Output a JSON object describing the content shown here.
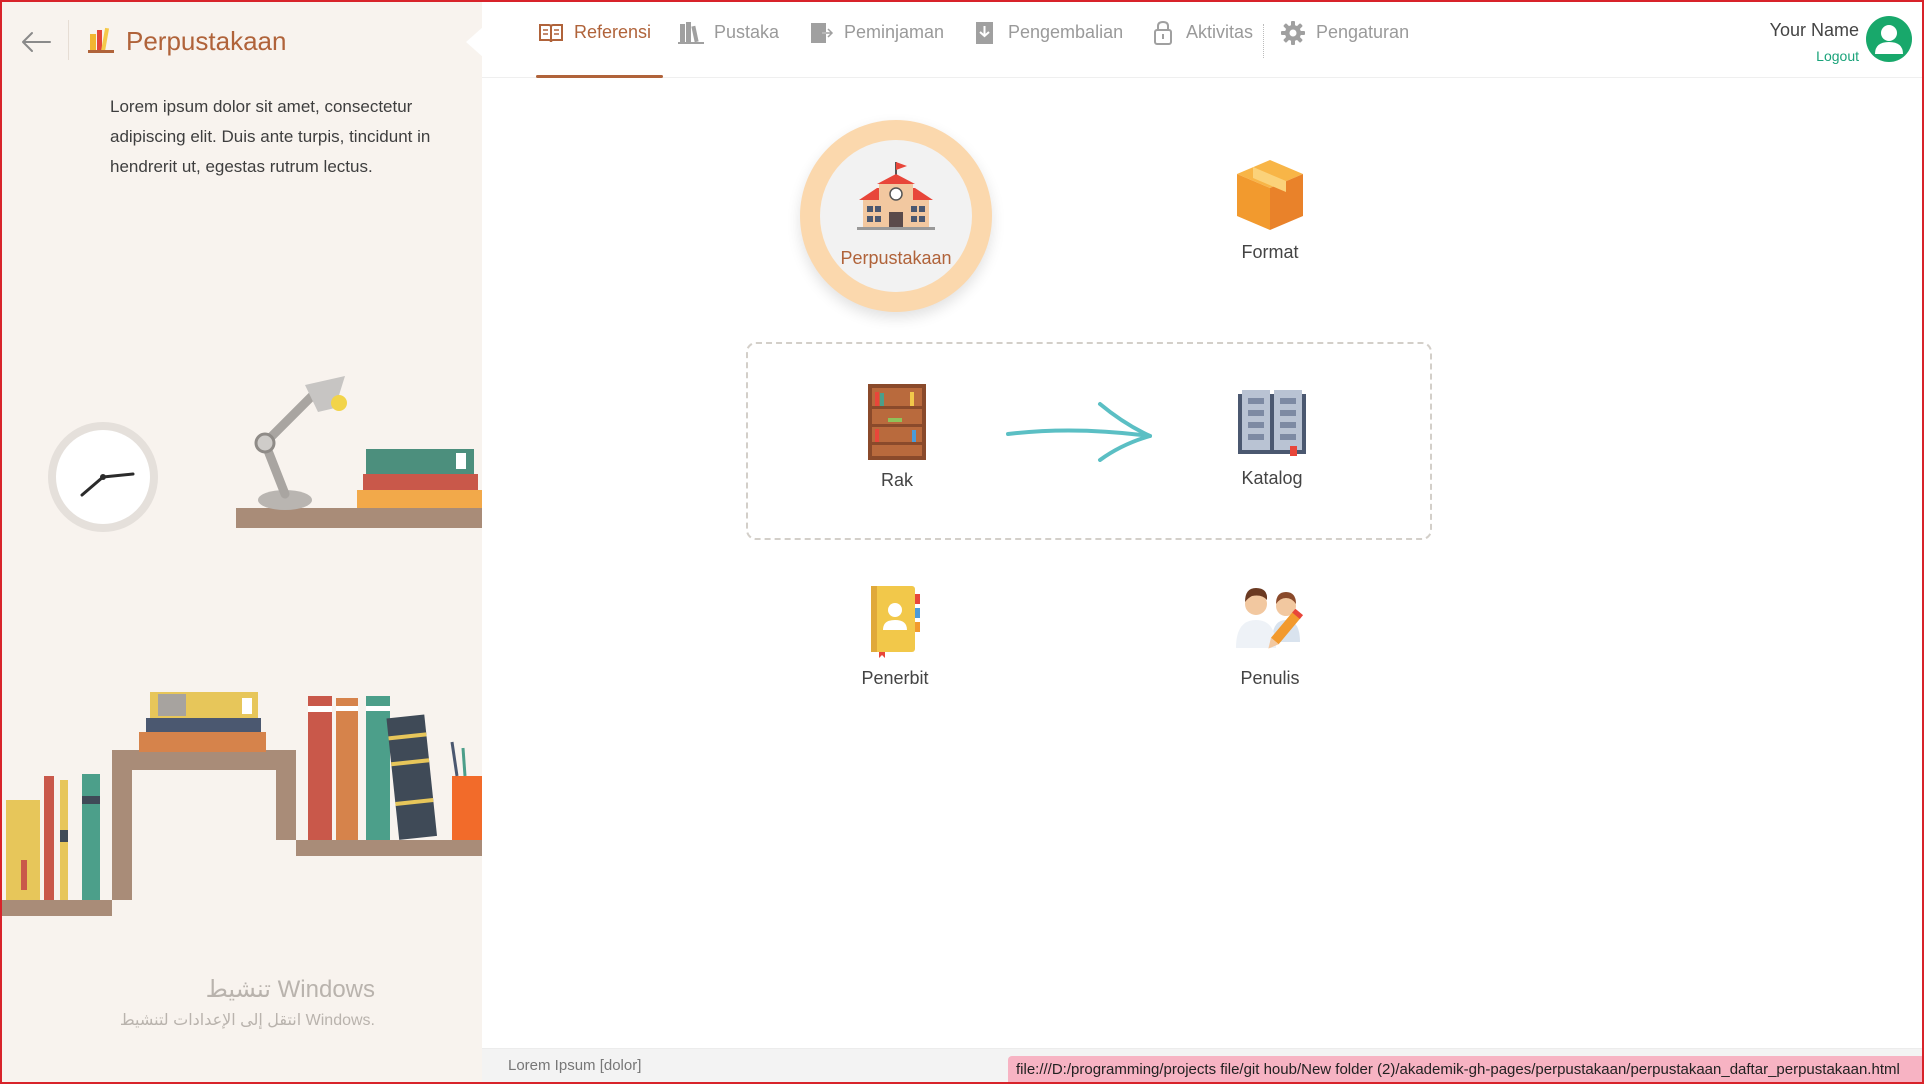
{
  "app": {
    "title": "Perpustakaan",
    "description": "Lorem ipsum dolor sit amet, consectetur adipiscing elit. Duis ante turpis, tincidunt in hendrerit ut, egestas rutrum lectus."
  },
  "nav": {
    "tabs": [
      {
        "label": "Referensi",
        "icon": "book-open-icon",
        "active": true
      },
      {
        "label": "Pustaka",
        "icon": "books-icon",
        "active": false
      },
      {
        "label": "Peminjaman",
        "icon": "borrow-icon",
        "active": false
      },
      {
        "label": "Pengembalian",
        "icon": "return-icon",
        "active": false
      },
      {
        "label": "Aktivitas",
        "icon": "activity-icon",
        "active": false
      },
      {
        "label": "Pengaturan",
        "icon": "gear-icon",
        "active": false
      }
    ]
  },
  "user": {
    "name": "Your Name",
    "logout_label": "Logout"
  },
  "tiles": {
    "perpustakaan": "Perpustakaan",
    "format": "Format",
    "rak": "Rak",
    "katalog": "Katalog",
    "penerbit": "Penerbit",
    "penulis": "Penulis"
  },
  "watermark": {
    "line1": "تنشيط Windows",
    "line2": "انتقل إلى الإعدادات لتنشيط Windows."
  },
  "status": {
    "text": "Lorem Ipsum [dolor]",
    "url": "file:///D:/programming/projects file/git houb/New folder (2)/akademik-gh-pages/perpustakaan/perpustakaan_daftar_perpustakaan.html"
  },
  "colors": {
    "accent": "#b0633a",
    "sidebar_bg": "#f8f3ee",
    "avatar_green": "#18a86b",
    "arrow_teal": "#5bbfc4"
  }
}
